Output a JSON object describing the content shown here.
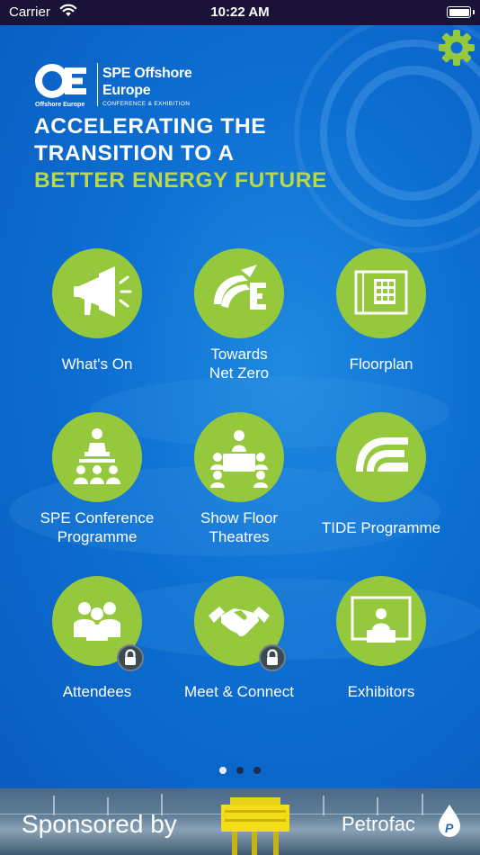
{
  "status_bar": {
    "carrier": "Carrier",
    "time": "10:22 AM",
    "wifi_icon": "wifi-icon",
    "battery_icon": "battery-full-icon"
  },
  "header": {
    "settings_icon": "gear-icon",
    "logo": {
      "mark_text": "Offshore Europe",
      "brand_line1": "SPE Offshore",
      "brand_line2": "Europe",
      "subtitle": "CONFERENCE & EXHIBITION"
    },
    "headline": {
      "line1": "ACCELERATING THE",
      "line2": "TRANSITION TO A",
      "line3": "BETTER ENERGY FUTURE"
    }
  },
  "menu": {
    "tiles": [
      {
        "label_line1": "What's On",
        "label_line2": "",
        "icon": "megaphone-icon",
        "locked": false
      },
      {
        "label_line1": "Towards",
        "label_line2": "Net Zero",
        "icon": "net-zero-logo-icon",
        "locked": false
      },
      {
        "label_line1": "Floorplan",
        "label_line2": "",
        "icon": "floorplan-icon",
        "locked": false
      },
      {
        "label_line1": "SPE Conference",
        "label_line2": "Programme",
        "icon": "speaker-podium-icon",
        "locked": false
      },
      {
        "label_line1": "Show Floor",
        "label_line2": "Theatres",
        "icon": "meeting-table-icon",
        "locked": false
      },
      {
        "label_line1": "TIDE Programme",
        "label_line2": "",
        "icon": "tide-logo-icon",
        "locked": false
      },
      {
        "label_line1": "Attendees",
        "label_line2": "",
        "icon": "attendees-group-icon",
        "locked": true
      },
      {
        "label_line1": "Meet & Connect",
        "label_line2": "",
        "icon": "handshake-icon",
        "locked": true
      },
      {
        "label_line1": "Exhibitors",
        "label_line2": "",
        "icon": "exhibitor-screen-icon",
        "locked": false
      }
    ],
    "lock_icon": "lock-icon"
  },
  "pagination": {
    "pages": 3,
    "current": 1
  },
  "sponsor": {
    "label": "Sponsored by",
    "sponsor_name": "Petrofac",
    "sponsor_mark_icon": "petrofac-logo-icon"
  },
  "colors": {
    "background": "#0d6fd2",
    "tile_green": "#95c83d",
    "headline_accent": "#b6d84a",
    "status_bar": "#1b1237"
  }
}
